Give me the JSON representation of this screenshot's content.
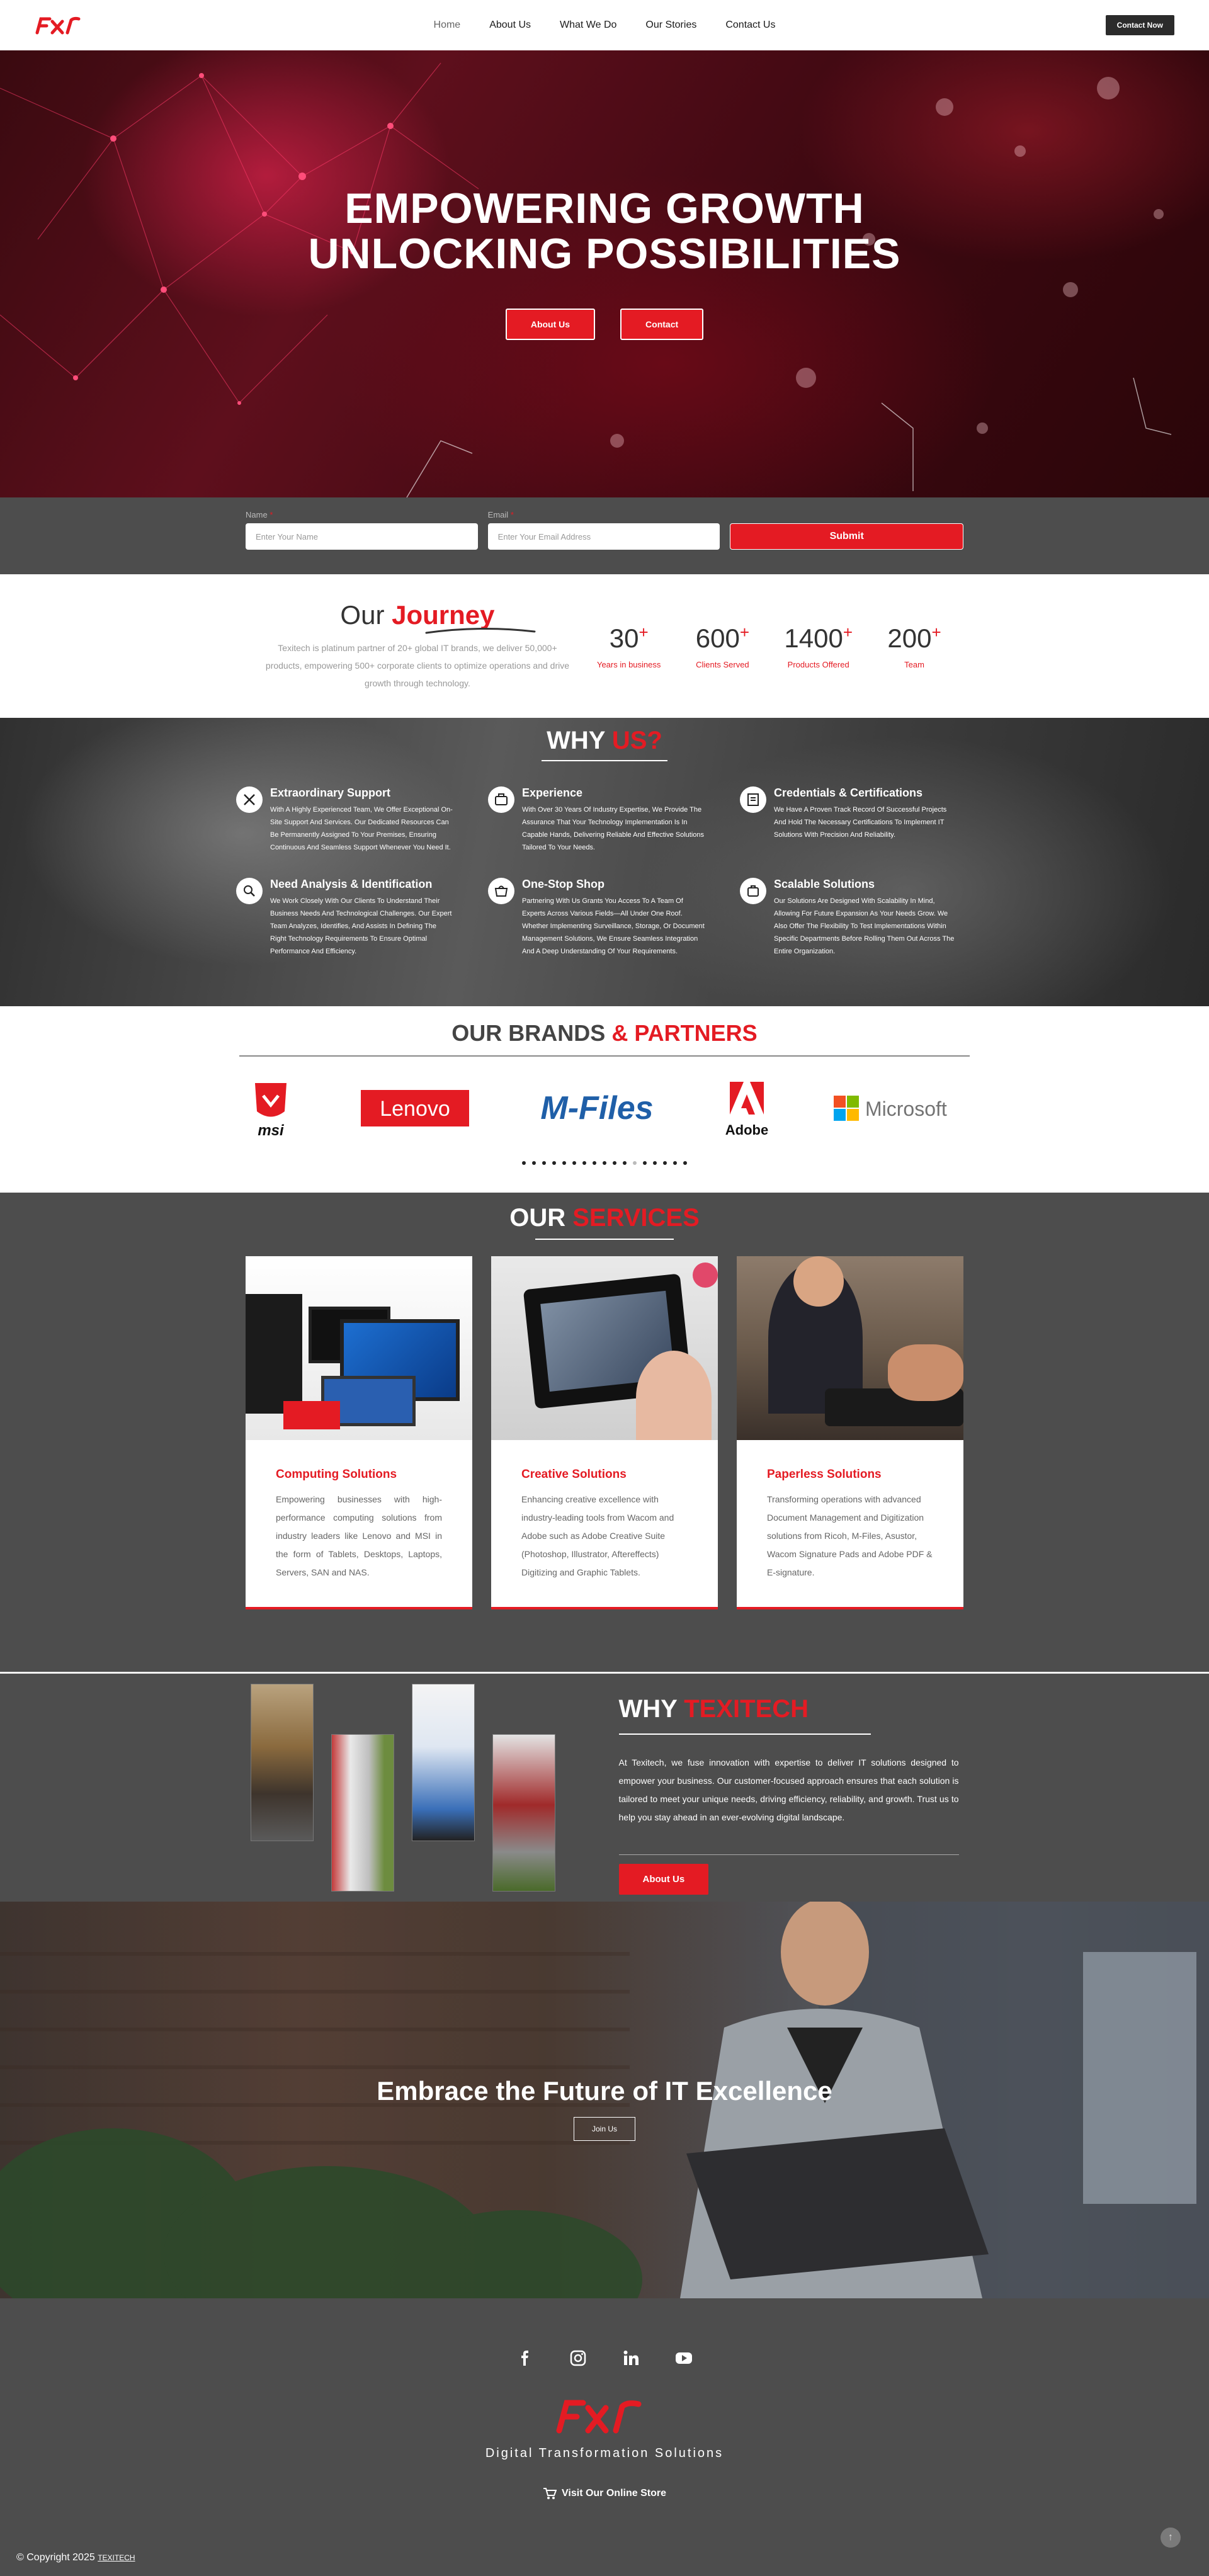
{
  "header": {
    "nav": [
      "Home",
      "About Us",
      "What We Do",
      "Our Stories",
      "Contact Us"
    ],
    "contact_button": "Contact Now"
  },
  "hero": {
    "title_line1": "EMPOWERING GROWTH",
    "title_line2": "UNLOCKING POSSIBILITIES",
    "btn_about": "About Us",
    "btn_contact": "Contact"
  },
  "form": {
    "name_label": "Name",
    "name_placeholder": "Enter Your Name",
    "email_label": "Email",
    "email_placeholder": "Enter Your Email Address",
    "submit": "Submit"
  },
  "journey": {
    "title_plain": "Our",
    "title_accent": "Journey",
    "text": "Texitech is platinum partner of 20+ global IT brands, we deliver 50,000+ products, empowering 500+ corporate clients to optimize operations and drive growth through technology.",
    "stats": [
      {
        "num": "30",
        "label": "Years in business"
      },
      {
        "num": "600",
        "label": "Clients Served"
      },
      {
        "num": "1400",
        "label": "Products Offered"
      },
      {
        "num": "200",
        "label": "Team"
      }
    ]
  },
  "whyus": {
    "title_plain": "WHY",
    "title_accent": "US?",
    "items": [
      {
        "title": "Extraordinary Support",
        "desc": "With A Highly Experienced Team, We Offer Exceptional On-Site Support And Services. Our Dedicated Resources Can Be Permanently Assigned To Your Premises, Ensuring Continuous And Seamless Support Whenever You Need It."
      },
      {
        "title": "Experience",
        "desc": "With Over 30 Years Of Industry Expertise, We Provide The Assurance That Your Technology Implementation Is In Capable Hands, Delivering Reliable And Effective Solutions Tailored To Your Needs."
      },
      {
        "title": "Credentials & Certifications",
        "desc": "We Have A Proven Track Record Of Successful Projects And Hold The Necessary Certifications To Implement IT Solutions With Precision And Reliability."
      },
      {
        "title": "Need Analysis & Identification",
        "desc": "We Work Closely With Our Clients To Understand Their Business Needs And Technological Challenges. Our Expert Team Analyzes, Identifies, And Assists In Defining The Right Technology Requirements To Ensure Optimal Performance And Efficiency."
      },
      {
        "title": "One-Stop Shop",
        "desc": "Partnering With Us Grants You Access To A Team Of Experts Across Various Fields—All Under One Roof. Whether Implementing Surveillance, Storage, Or Document Management Solutions, We Ensure Seamless Integration And A Deep Understanding Of Your Requirements."
      },
      {
        "title": "Scalable Solutions",
        "desc": "Our Solutions Are Designed With Scalability In Mind, Allowing For Future Expansion As Your Needs Grow. We Also Offer The Flexibility To Test Implementations Within Specific Departments Before Rolling Them Out Across The Entire Organization."
      }
    ]
  },
  "brands": {
    "title_plain": "OUR BRANDS",
    "title_accent": "& PARTNERS",
    "logos": [
      "msi",
      "Lenovo",
      "M-Files",
      "Adobe",
      "Microsoft"
    ]
  },
  "services": {
    "title_plain": "OUR",
    "title_accent": "SERVICES",
    "cards": [
      {
        "title": "Computing Solutions",
        "text": "Empowering businesses with high-performance computing solutions from industry leaders like Lenovo and MSI in the form of Tablets, Desktops, Laptops, Servers, SAN and NAS."
      },
      {
        "title": "Creative Solutions",
        "text": "Enhancing creative excellence with industry-leading tools from Wacom and Adobe such as Adobe Creative Suite (Photoshop, Illustrator, Aftereffects) Digitizing and Graphic Tablets."
      },
      {
        "title": "Paperless Solutions",
        "text": "Transforming operations with advanced Document Management and Digitization solutions from Ricoh, M-Files, Asustor, Wacom Signature Pads and Adobe PDF & E-signature."
      }
    ]
  },
  "whytexitech": {
    "title_plain": "WHY",
    "title_accent": "TEXITECH",
    "text": "At Texitech, we fuse innovation with expertise to deliver IT solutions designed to empower your business. Our customer-focused approach ensures that each solution is tailored to meet your unique needs, driving efficiency, reliability, and growth. Trust us to help you stay ahead in an ever-evolving digital landscape.",
    "button": "About Us"
  },
  "embrace": {
    "title": "Embrace the Future of IT Excellence",
    "button": "Join Us"
  },
  "footer": {
    "tagline": "Digital Transformation Solutions",
    "store": "Visit Our Online Store",
    "copyright": "© Copyright 2025",
    "brand": "TEXITECH"
  },
  "colors": {
    "accent": "#e41b23",
    "dark": "#4d4d4d"
  }
}
